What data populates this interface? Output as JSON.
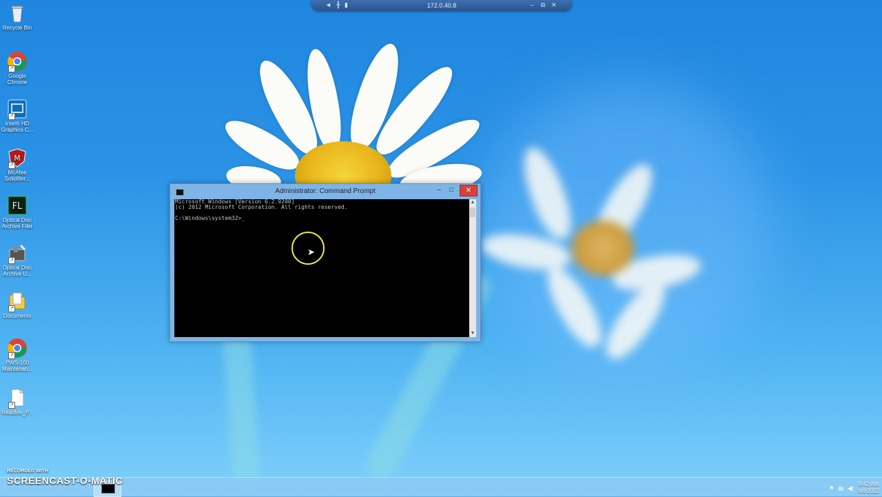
{
  "rdp_bar": {
    "address": "172.0.40.8",
    "pin_icon": "pin-icon",
    "signal_icon": "signal-icon",
    "min_icon": "minimize-icon",
    "restore_icon": "restore-icon",
    "close_icon": "close-icon"
  },
  "desktop_icons": [
    {
      "label": "Recycle Bin",
      "icon": "recycle-bin-icon"
    },
    {
      "label": "Google Chrome",
      "icon": "chrome-icon"
    },
    {
      "label": "Intel® HD Graphics C...",
      "icon": "intel-graphics-icon"
    },
    {
      "label": "McAfee Solidifier...",
      "icon": "mcafee-icon"
    },
    {
      "label": "Optical Disc Archive Filer",
      "icon": "fl-icon"
    },
    {
      "label": "Optical Disc Archive U...",
      "icon": "disc-utility-icon"
    },
    {
      "label": "Documents",
      "icon": "folder-icon"
    },
    {
      "label": "PWS-100 Maintenan...",
      "icon": "chrome-icon"
    },
    {
      "label": "ReadMe_P...",
      "icon": "file-icon"
    }
  ],
  "cmd": {
    "title": "Administrator: Command Prompt",
    "lines": [
      "Microsoft Windows [Version 6.2.9200]",
      "(c) 2012 Microsoft Corporation. All rights reserved.",
      "",
      "C:\\Windows\\system32>_"
    ],
    "min_label": "–",
    "max_label": "□",
    "close_label": "✕"
  },
  "taskbar": {
    "time": "9:42 AM",
    "date": "9/8/2022"
  },
  "watermark": {
    "small": "RECORDED WITH",
    "big": "SCREENCAST-O-MATIC"
  },
  "colors": {
    "close_button": "#d8413a",
    "console_bg": "#000000",
    "window_frame": "#7fb5e6"
  }
}
